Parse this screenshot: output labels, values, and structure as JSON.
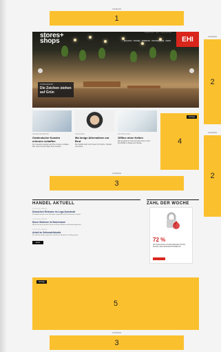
{
  "ads": {
    "top": {
      "label": "Anzeige",
      "num": "1"
    },
    "right_1": {
      "label": "Anzeige",
      "num": "2"
    },
    "right_2": {
      "label": "Anzeige",
      "num": "2"
    },
    "middle": {
      "label": "Anzeige",
      "num": "3"
    },
    "box_4": {
      "tag": "Anzeige",
      "num": "4"
    },
    "box_5": {
      "tag": "Anzeige",
      "num": "5"
    },
    "bottom": {
      "label": "Anzeige",
      "num": "3"
    }
  },
  "header": {
    "logo_line1": "stores+",
    "logo_line2": "shops",
    "util_links": "WEBSITE · EHI · REGISTER",
    "nav": "MAGAZIN · HANDEL · FORMATE · TECHNOLOGIE · NEWS",
    "ehi": "EHI"
  },
  "hero": {
    "kicker": "STORE REPORT",
    "title": "Die Zeichen stehen auf Grün"
  },
  "teasers": [
    {
      "kicker": "HANDELSFORMATE",
      "title": "Ostdeutsche Kunden erinnern schaffen",
      "text": "Kurz gesehen werden auf Ihre Kunden schaffen. Das neue Format bietet Ihren Kunden."
    },
    {
      "kicker": "INTERVIEW",
      "title": "Ma Innige Alternativen zur Brut",
      "text": "Die Vielfalt steht noch heute für Frische. Handel und Kultur."
    },
    {
      "kicker": "TECHNOLOGIE",
      "title": "Offline ohne Ketten",
      "text": "Das Angebot im Internet bietet Ihnen mehr Flexibilität im Alltag und Handel."
    }
  ],
  "news": {
    "title": "HANDEL AKTUELL",
    "items": [
      {
        "kicker": "03.04.2023 | HANDEL",
        "title": "Deutsches Relevanz im Logo-Konstrukt",
        "text": "Im Handel werden neue Konzepte vorgestellt und die Resonanz ist groß."
      },
      {
        "kicker": "03.04.2023 | HANDEL",
        "title": "Neuer Moderne im Nutzerraum",
        "text": "Mit der Neuheit wird die Frische im Fokus bleiben und Kunden begeistert."
      },
      {
        "kicker": "03.04.2023 | HANDEL",
        "title": "Arbeit im Seilmodellstudie",
        "text": "Die aktuelle Studie zeigt, dass Kunden im Handel neue Wege gehen."
      }
    ],
    "more": "MEHR"
  },
  "zdw": {
    "title": "ZAHL DER WOCHE",
    "pct": "72 %",
    "text": "der Unternehmen im Einzelhandel sind der Ansicht, dass Sicherheit Priorität hat."
  }
}
